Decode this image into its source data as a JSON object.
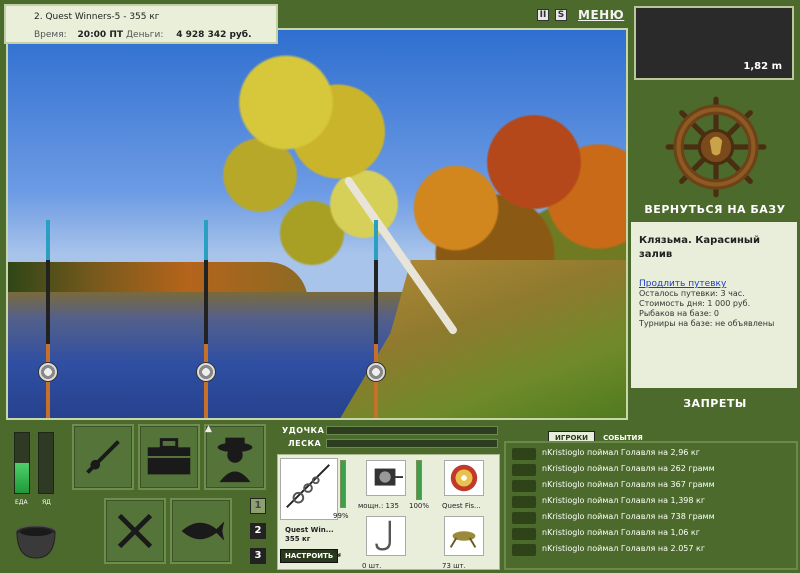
{
  "hud": {
    "session_line": "2. Quest Winners-5 - 355 кг",
    "time_label": "Время:",
    "time_value": "20:00 ПТ",
    "money_label": "Деньги:",
    "money_value": "4 928 342 руб.",
    "icon_pause": "II",
    "icon_sound": "S",
    "menu_label": "МЕНЮ"
  },
  "depth": {
    "value": "1,82 m"
  },
  "base": {
    "return_label": "ВЕРНУТЬСЯ НА БАЗУ",
    "location_title": "Клязьма. Карасиный залив",
    "extend_link": "Продлить путевку",
    "permit_left": "Осталось путевки: 3 час.",
    "day_cost": "Стоимость дня: 1 000 руб.",
    "anglers": "Рыбаков на базе: 0",
    "tournaments": "Турниры на базе: не объявлены",
    "bans_label": "ЗАПРЕТЫ"
  },
  "status_bars": {
    "food_label": "ЕДА",
    "food_level": 0.5,
    "poison_label": "ЯД",
    "poison_level": 0.0
  },
  "slot_numbers": [
    "1",
    "2",
    "3"
  ],
  "tackle": {
    "rod_label": "УДОЧКА",
    "line_label": "ЛЕСКА",
    "rod_name": "Quest Win...",
    "rod_weight": "355 кг",
    "rod_condition": "99%",
    "rod_condition_level": 0.99,
    "reel_power": "мощн.: 135",
    "reel_condition": "100%",
    "reel_condition_level": 1.0,
    "line_name": "Quest Fis...",
    "hook_count": "0 шт.",
    "bait_count": "73 шт.",
    "tune_label": "НАСТРОИТЬ"
  },
  "chat": {
    "tab_players": "ИГРОКИ",
    "tab_events": "СОБЫТИЯ",
    "messages": [
      "nKristioglo поймал Голавля на 2,96 кг",
      "nKristioglo поймал Голавля на 262 грамм",
      "nKristioglo поймал Голавля на 367 грамм",
      "nKristioglo поймал Голавля на 1,398 кг",
      "nKristioglo поймал Голавля на 738 грамм",
      "nKristioglo поймал Голавля на 1,06 кг",
      "nKristioglo поймал Голавля на 2.057 кг"
    ]
  }
}
